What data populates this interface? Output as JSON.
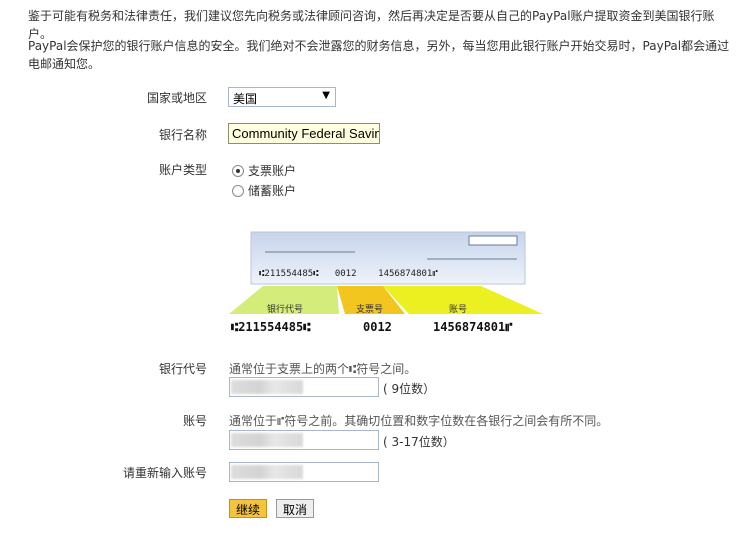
{
  "intro": {
    "line1": "鉴于可能有税务和法律责任，我们建议您先向税务或法律顾问咨询，然后再决定是否要从自己的PayPal账户提取资金到美国银行账户。",
    "line2": "PayPal会保护您的银行账户信息的安全。我们绝对不会泄露您的财务信息，另外，每当您用此银行账户开始交易时，PayPal都会通过电邮通知您。"
  },
  "form": {
    "country_label": "国家或地区",
    "country_value": "美国",
    "bank_name_label": "银行名称",
    "bank_name_value": "Community Federal Savings",
    "account_type_label": "账户类型",
    "account_types": [
      {
        "label": "支票账户",
        "checked": true
      },
      {
        "label": "储蓄账户",
        "checked": false
      }
    ],
    "routing_label": "银行代号",
    "routing_hint": "通常位于支票上的两个⑆符号之间。",
    "routing_suffix": "( 9位数）",
    "account_label": "账号",
    "account_hint": "通常位于⑈符号之前。其确切位置和数字位数在各银行之间会有所不同。",
    "account_suffix": "( 3-17位数）",
    "reenter_label": "请重新输入账号",
    "continue_label": "继续",
    "cancel_label": "取消"
  },
  "check_image": {
    "micr_line_small": "⑆211554485⑆   0012    1456874801⑈",
    "routing_tab": "银行代号",
    "check_tab": "支票号",
    "account_tab": "账号",
    "routing_number": "⑆211554485⑆",
    "check_number": "0012",
    "account_number": "1456874801⑈",
    "colors": {
      "routing": "#d4ec7a",
      "check": "#f2c51f",
      "account": "#edf020"
    }
  }
}
